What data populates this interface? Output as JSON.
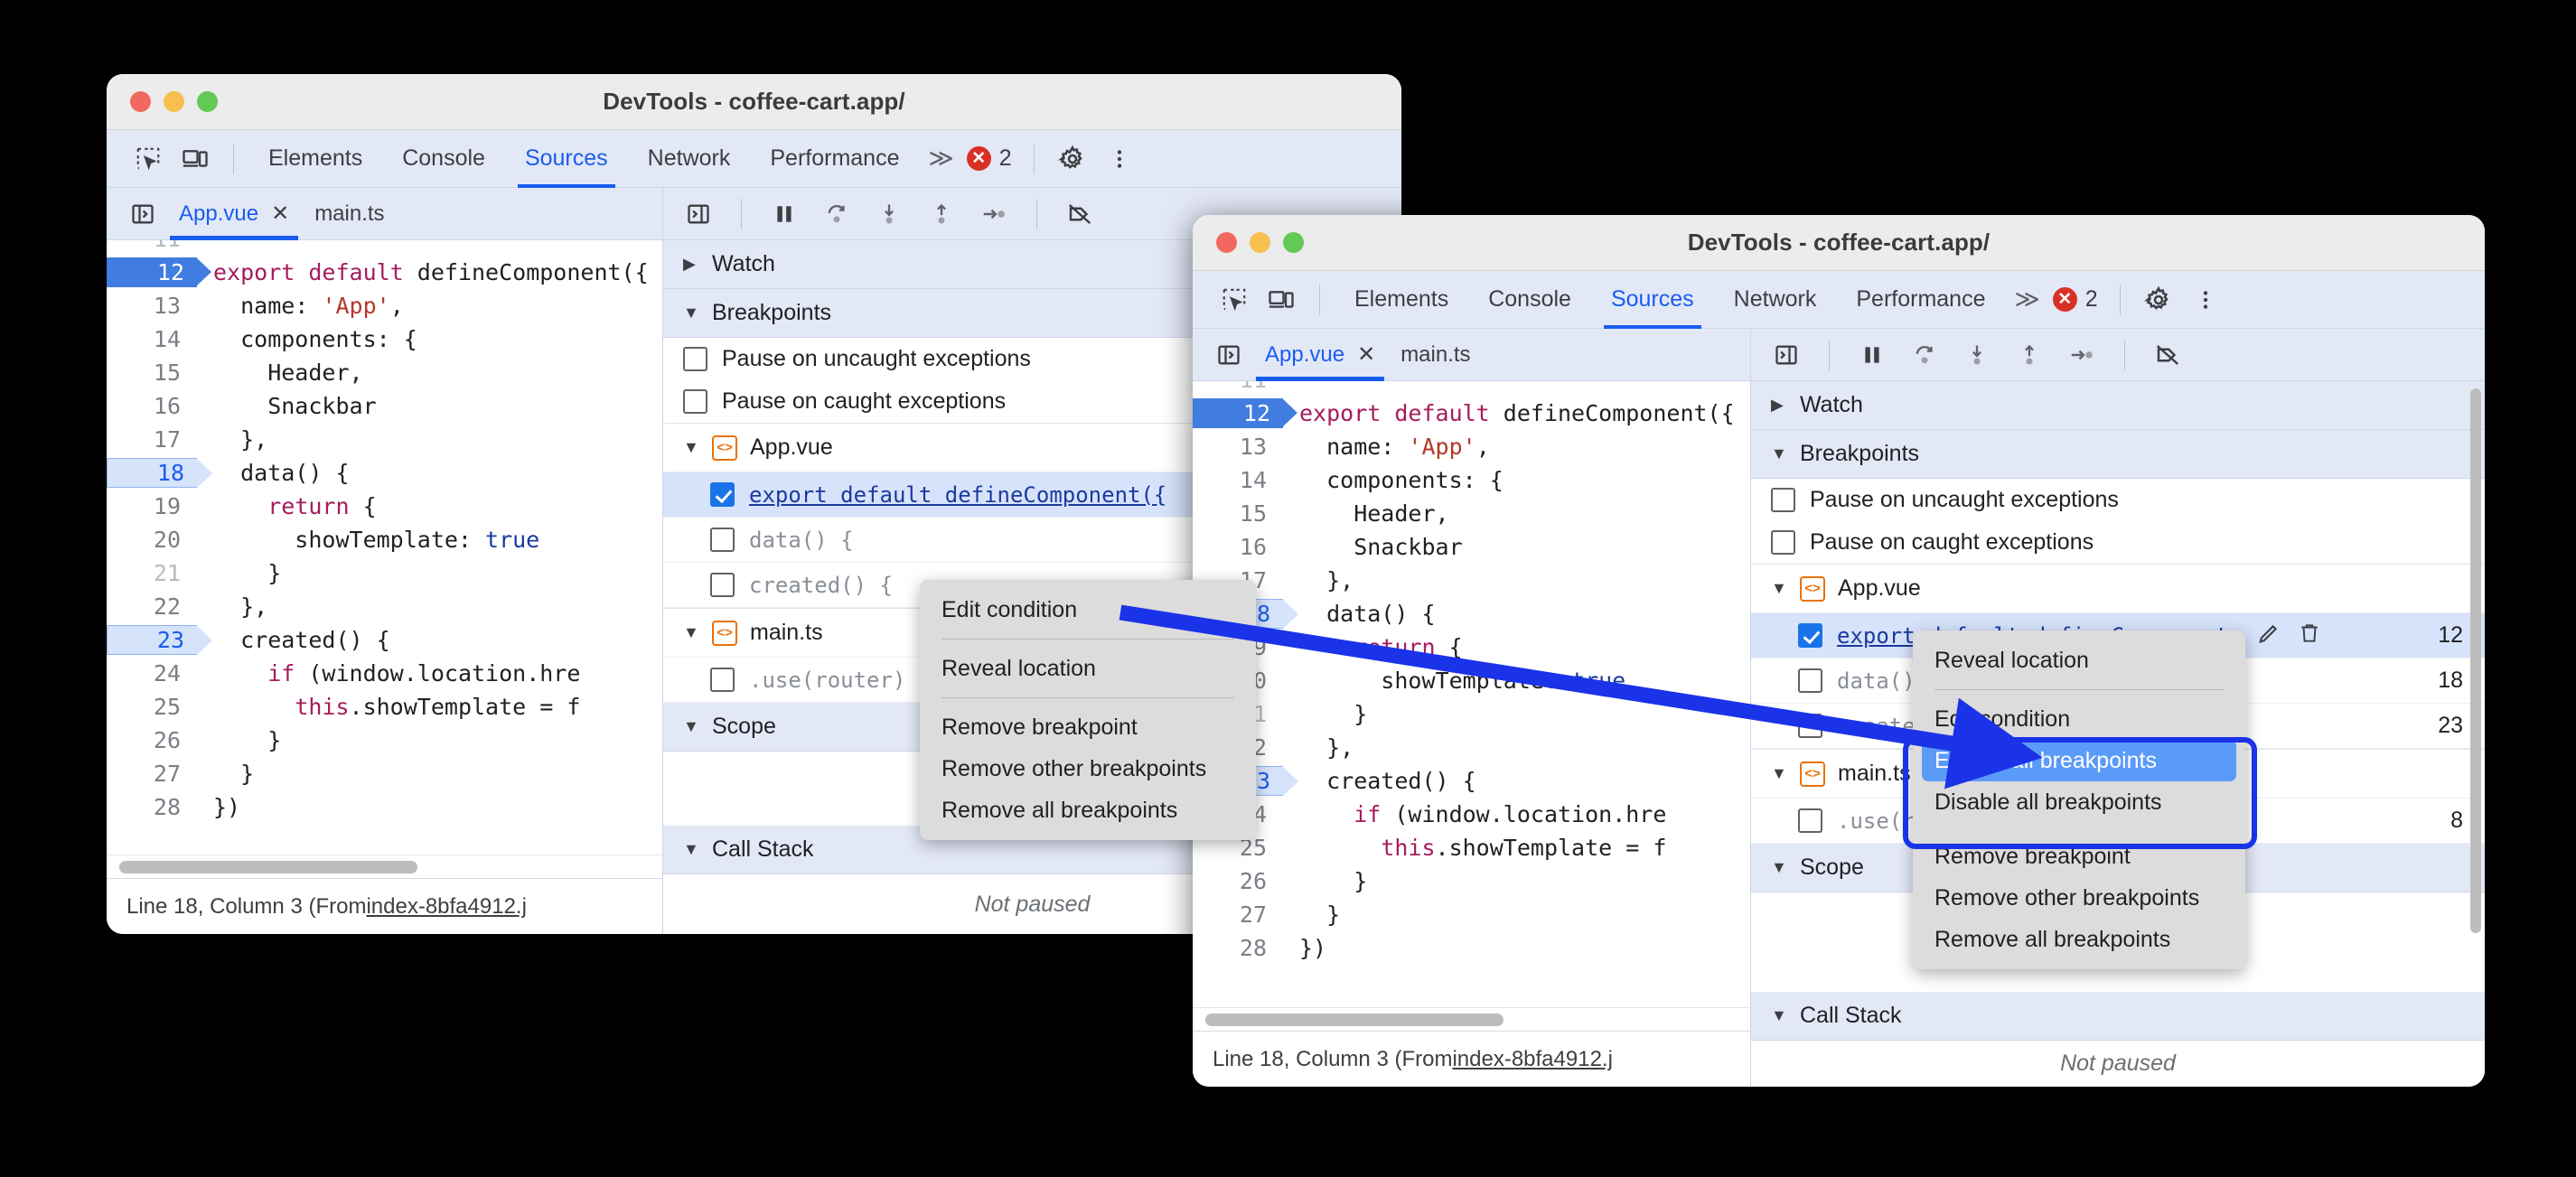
{
  "windows": {
    "back": {
      "title": "DevTools - coffee-cart.app/",
      "panel_tabs": [
        {
          "label": "Elements",
          "active": false
        },
        {
          "label": "Console",
          "active": false
        },
        {
          "label": "Sources",
          "active": true
        },
        {
          "label": "Network",
          "active": false
        },
        {
          "label": "Performance",
          "active": false
        }
      ],
      "overflow_label": "≫",
      "error_count": "2",
      "file_tabs": [
        {
          "label": "App.vue",
          "active": true,
          "closable": true
        },
        {
          "label": "main.ts",
          "active": false,
          "closable": false
        }
      ],
      "status": {
        "prefix": "Line 18, Column 3 (From ",
        "link": "index-8bfa4912.j"
      },
      "sections": {
        "watch": "Watch",
        "breakpoints": "Breakpoints",
        "scope": "Scope",
        "call_stack": "Call Stack",
        "not_paused": "Not paused"
      },
      "pause_options": [
        {
          "label": "Pause on uncaught exceptions",
          "checked": false
        },
        {
          "label": "Pause on caught exceptions",
          "checked": false
        }
      ],
      "bp_groups": [
        {
          "file": "App.vue",
          "items": [
            {
              "label": "export default defineComponent({",
              "checked": true,
              "selected": true,
              "line": "12"
            },
            {
              "label": "data() {",
              "checked": false,
              "selected": false,
              "line": "18"
            },
            {
              "label": "created() {",
              "checked": false,
              "selected": false,
              "line": "23"
            }
          ]
        },
        {
          "file": "main.ts",
          "items": [
            {
              "label": ".use(router)",
              "checked": false,
              "selected": false,
              "line": "8"
            }
          ]
        }
      ],
      "context_menu": [
        {
          "label": "Edit condition",
          "type": "item",
          "highlight": false
        },
        {
          "label": "",
          "type": "sep",
          "highlight": false
        },
        {
          "label": "Reveal location",
          "type": "item",
          "highlight": false
        },
        {
          "label": "",
          "type": "sep",
          "highlight": false
        },
        {
          "label": "Remove breakpoint",
          "type": "item",
          "highlight": false
        },
        {
          "label": "Remove other breakpoints",
          "type": "item",
          "highlight": false
        },
        {
          "label": "Remove all breakpoints",
          "type": "item",
          "highlight": false
        }
      ]
    },
    "front": {
      "title": "DevTools - coffee-cart.app/",
      "panel_tabs": [
        {
          "label": "Elements",
          "active": false
        },
        {
          "label": "Console",
          "active": false
        },
        {
          "label": "Sources",
          "active": true
        },
        {
          "label": "Network",
          "active": false
        },
        {
          "label": "Performance",
          "active": false
        }
      ],
      "overflow_label": "≫",
      "error_count": "2",
      "file_tabs": [
        {
          "label": "App.vue",
          "active": true,
          "closable": true
        },
        {
          "label": "main.ts",
          "active": false,
          "closable": false
        }
      ],
      "status": {
        "prefix": "Line 18, Column 3 (From ",
        "link": "index-8bfa4912.j"
      },
      "sections": {
        "watch": "Watch",
        "breakpoints": "Breakpoints",
        "scope": "Scope",
        "call_stack": "Call Stack",
        "not_paused": "Not paused"
      },
      "pause_options": [
        {
          "label": "Pause on uncaught exceptions",
          "checked": false
        },
        {
          "label": "Pause on caught exceptions",
          "checked": false
        }
      ],
      "bp_groups": [
        {
          "file": "App.vue",
          "items": [
            {
              "label": "export default defineComponent…",
              "checked": true,
              "selected": true,
              "line": "12"
            },
            {
              "label": "data()",
              "checked": false,
              "selected": false,
              "line": "18"
            },
            {
              "label": "created()",
              "checked": false,
              "selected": false,
              "line": "23"
            }
          ]
        },
        {
          "file": "main.ts",
          "items": [
            {
              "label": ".use(r",
              "checked": false,
              "selected": false,
              "line": "8"
            }
          ]
        }
      ],
      "context_menu": [
        {
          "label": "Reveal location",
          "type": "item",
          "highlight": false
        },
        {
          "label": "",
          "type": "sep",
          "highlight": false
        },
        {
          "label": "Edit condition",
          "type": "item",
          "highlight": false
        },
        {
          "label": "Enable all breakpoints",
          "type": "item",
          "highlight": true
        },
        {
          "label": "Disable all breakpoints",
          "type": "item",
          "highlight": false
        },
        {
          "label": "Remove breakpoint",
          "type": "item",
          "highlight": false
        },
        {
          "label": "Remove other breakpoints",
          "type": "item",
          "highlight": false
        },
        {
          "label": "Remove all breakpoints",
          "type": "item",
          "highlight": false
        }
      ]
    }
  },
  "code": {
    "partial_top_line": "11",
    "lines": [
      {
        "n": "12",
        "bp": "solid",
        "dim": false,
        "indent": 0,
        "tokens": [
          {
            "t": "export",
            "c": "k"
          },
          {
            "t": " ",
            "c": ""
          },
          {
            "t": "default",
            "c": "k"
          },
          {
            "t": " defineComponent({",
            "c": ""
          }
        ]
      },
      {
        "n": "13",
        "bp": "none",
        "dim": false,
        "indent": 1,
        "tokens": [
          {
            "t": "  name: ",
            "c": ""
          },
          {
            "t": "'App'",
            "c": "s"
          },
          {
            "t": ",",
            "c": ""
          }
        ]
      },
      {
        "n": "14",
        "bp": "none",
        "dim": false,
        "indent": 1,
        "tokens": [
          {
            "t": "  components: {",
            "c": ""
          }
        ]
      },
      {
        "n": "15",
        "bp": "none",
        "dim": false,
        "indent": 2,
        "tokens": [
          {
            "t": "    Header,",
            "c": ""
          }
        ]
      },
      {
        "n": "16",
        "bp": "none",
        "dim": false,
        "indent": 2,
        "tokens": [
          {
            "t": "    Snackbar",
            "c": ""
          }
        ]
      },
      {
        "n": "17",
        "bp": "none",
        "dim": false,
        "indent": 1,
        "tokens": [
          {
            "t": "  },",
            "c": ""
          }
        ]
      },
      {
        "n": "18",
        "bp": "hollow",
        "dim": false,
        "indent": 1,
        "tokens": [
          {
            "t": "  data() {",
            "c": ""
          }
        ]
      },
      {
        "n": "19",
        "bp": "none",
        "dim": false,
        "indent": 2,
        "tokens": [
          {
            "t": "    ",
            "c": ""
          },
          {
            "t": "return",
            "c": "k"
          },
          {
            "t": " {",
            "c": ""
          }
        ]
      },
      {
        "n": "20",
        "bp": "none",
        "dim": false,
        "indent": 3,
        "tokens": [
          {
            "t": "      showTemplate: ",
            "c": ""
          },
          {
            "t": "true",
            "c": "b"
          }
        ]
      },
      {
        "n": "21",
        "bp": "none",
        "dim": true,
        "indent": 3,
        "tokens": [
          {
            "t": "    }",
            "c": ""
          }
        ]
      },
      {
        "n": "22",
        "bp": "none",
        "dim": false,
        "indent": 1,
        "tokens": [
          {
            "t": "  },",
            "c": ""
          }
        ]
      },
      {
        "n": "23",
        "bp": "hollow",
        "dim": false,
        "indent": 1,
        "tokens": [
          {
            "t": "  created() {",
            "c": ""
          }
        ]
      },
      {
        "n": "24",
        "bp": "none",
        "dim": false,
        "indent": 2,
        "tokens": [
          {
            "t": "    ",
            "c": ""
          },
          {
            "t": "if",
            "c": "k"
          },
          {
            "t": " (window.location.hre",
            "c": ""
          }
        ]
      },
      {
        "n": "25",
        "bp": "none",
        "dim": false,
        "indent": 3,
        "tokens": [
          {
            "t": "      ",
            "c": ""
          },
          {
            "t": "this",
            "c": "k"
          },
          {
            "t": ".showTemplate = f",
            "c": ""
          }
        ]
      },
      {
        "n": "26",
        "bp": "none",
        "dim": false,
        "indent": 2,
        "tokens": [
          {
            "t": "    }",
            "c": ""
          }
        ]
      },
      {
        "n": "27",
        "bp": "none",
        "dim": false,
        "indent": 1,
        "tokens": [
          {
            "t": "  }",
            "c": ""
          }
        ]
      },
      {
        "n": "28",
        "bp": "none",
        "dim": false,
        "indent": 0,
        "tokens": [
          {
            "t": "})",
            "c": ""
          }
        ]
      }
    ]
  },
  "colors": {
    "accent": "#1a5cf0",
    "selection": "#d7e3fb",
    "breakpoint": "#417ce0",
    "highlight_box": "#1a32e8",
    "menu_highlight": "#5b9bf8",
    "error": "#d93025",
    "vue_icon": "#e8710a"
  },
  "icons": {
    "inspect": "inspect-element-icon",
    "device": "device-toolbar-icon",
    "settings": "gear-icon",
    "more": "more-vertical-icon",
    "navigator": "show-navigator-icon",
    "debugger": "show-debugger-icon",
    "pause": "pause-icon",
    "step_over": "step-over-icon",
    "step_into": "step-into-icon",
    "step_out": "step-out-icon",
    "step": "step-icon",
    "deactivate_bp": "deactivate-breakpoints-icon",
    "edit": "pencil-icon",
    "delete": "trash-icon"
  }
}
